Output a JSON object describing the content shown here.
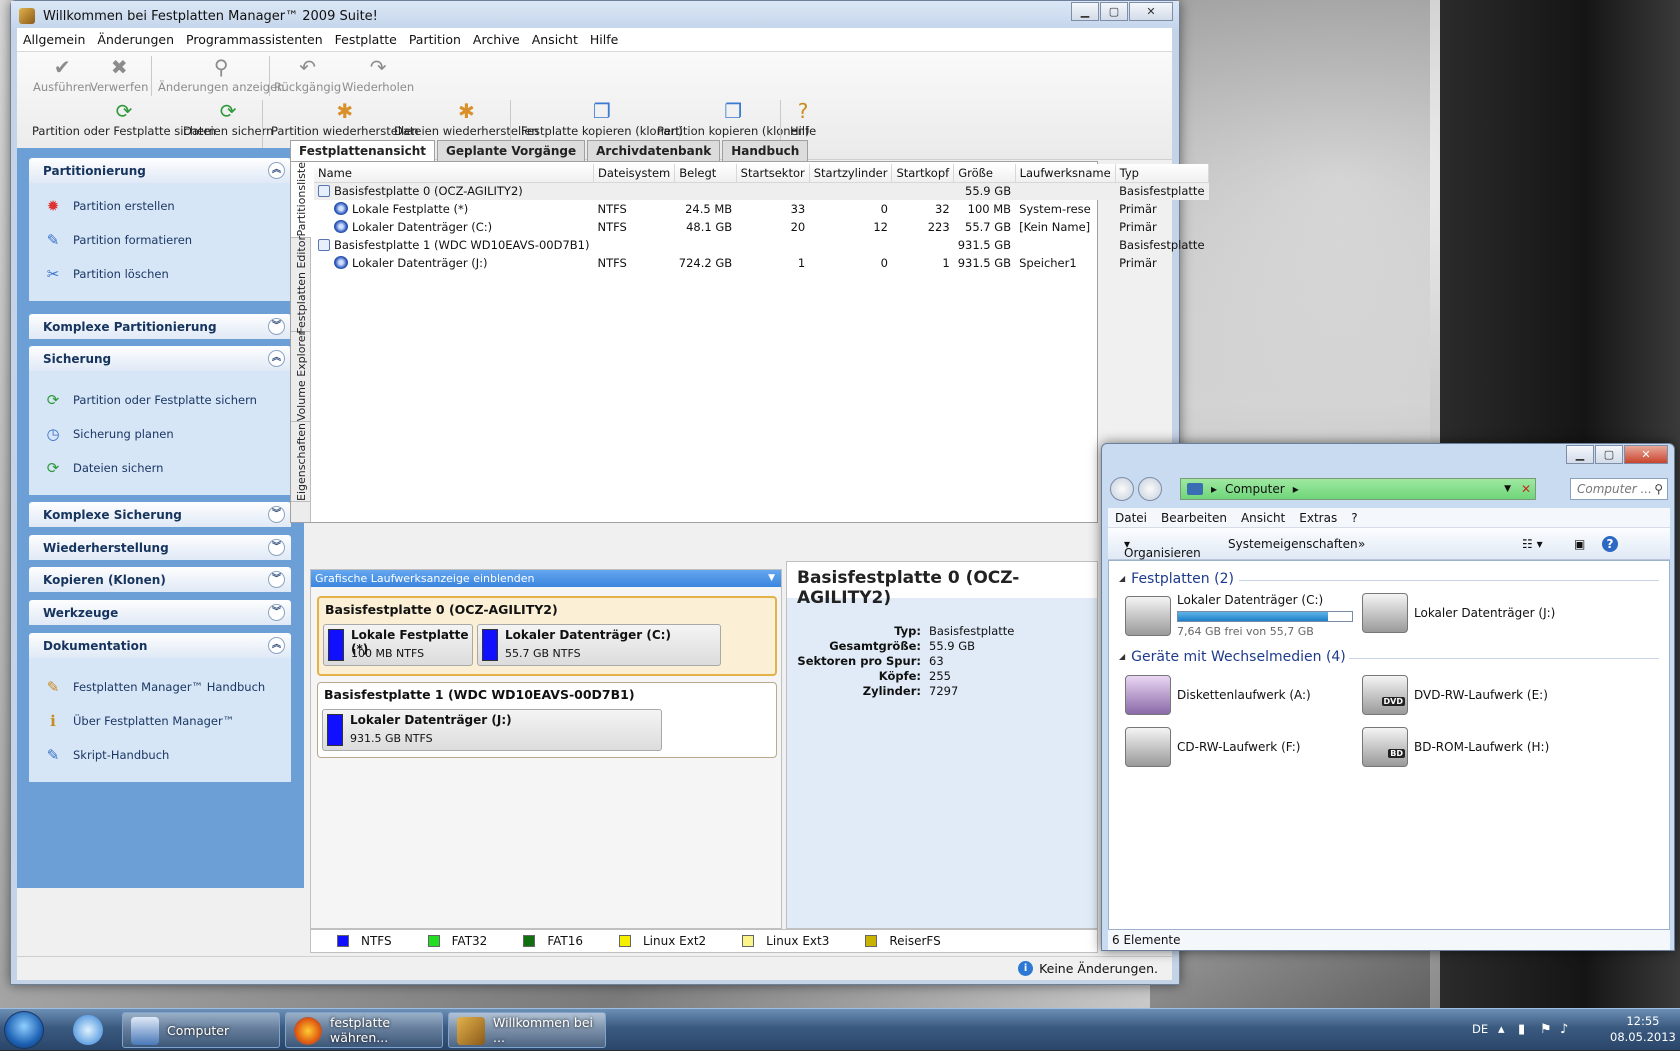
{
  "main_window": {
    "title": "Willkommen bei Festplatten Manager™ 2009 Suite!",
    "menu": [
      "Allgemein",
      "Änderungen",
      "Programmassistenten",
      "Festplatte",
      "Partition",
      "Archive",
      "Ansicht",
      "Hilfe"
    ],
    "toolbar_row1": [
      {
        "label": "Ausführen",
        "icon": "check-icon",
        "enabled": false
      },
      {
        "label": "Verwerfen",
        "icon": "x-icon",
        "enabled": false
      },
      {
        "label": "Änderungen anzeigen",
        "icon": "magnifier-icon",
        "enabled": false
      },
      {
        "label": "Rückgängig",
        "icon": "undo-icon",
        "enabled": false
      },
      {
        "label": "Wiederholen",
        "icon": "redo-icon",
        "enabled": false
      }
    ],
    "toolbar_row2": [
      {
        "label": "Partition oder Festplatte sichern",
        "icon": "backup-icon"
      },
      {
        "label": "Dateien sichern",
        "icon": "backup-files-icon"
      },
      {
        "label": "Partition wiederherstellen",
        "icon": "restore-icon"
      },
      {
        "label": "Dateien wiederherstellen",
        "icon": "restore-files-icon"
      },
      {
        "label": "Festplatte kopieren (klonen)",
        "icon": "clone-disk-icon"
      },
      {
        "label": "Partition kopieren (klonen)",
        "icon": "clone-partition-icon"
      },
      {
        "label": "Hilfe",
        "icon": "help-icon"
      }
    ],
    "sidebar": {
      "partitionierung": {
        "title": "Partitionierung",
        "items": [
          "Partition erstellen",
          "Partition formatieren",
          "Partition löschen"
        ]
      },
      "komplexe_partitionierung": {
        "title": "Komplexe Partitionierung"
      },
      "sicherung": {
        "title": "Sicherung",
        "items": [
          "Partition oder Festplatte sichern",
          "Sicherung planen",
          "Dateien sichern"
        ]
      },
      "komplexe_sicherung": {
        "title": "Komplexe Sicherung"
      },
      "wiederherstellung": {
        "title": "Wiederherstellung"
      },
      "kopieren": {
        "title": "Kopieren (Klonen)"
      },
      "werkzeuge": {
        "title": "Werkzeuge"
      },
      "dokumentation": {
        "title": "Dokumentation",
        "items": [
          "Festplatten Manager™ Handbuch",
          "Über Festplatten Manager™",
          "Skript-Handbuch"
        ]
      }
    },
    "tabs": [
      "Festplattenansicht",
      "Geplante Vorgänge",
      "Archivdatenbank",
      "Handbuch"
    ],
    "vertical_tabs": [
      "Partitionsliste",
      "Festplatten Editor",
      "Volume Explorer",
      "Eigenschaften"
    ],
    "table": {
      "headers": [
        "Name",
        "Dateisystem",
        "Belegt",
        "Startsektor",
        "Startzylinder",
        "Startkopf",
        "Größe",
        "Laufwerksname",
        "Typ"
      ],
      "rows": [
        [
          "Basisfestplatte 0 (OCZ-AGILITY2)",
          "",
          "",
          "",
          "",
          "",
          "55.9 GB",
          "",
          "Basisfestplatte"
        ],
        [
          "Lokale Festplatte (*)",
          "NTFS",
          "24.5 MB",
          "33",
          "0",
          "32",
          "100 MB",
          "System-rese",
          "Primär"
        ],
        [
          "Lokaler Datenträger (C:)",
          "NTFS",
          "48.1 GB",
          "20",
          "12",
          "223",
          "55.7 GB",
          "[Kein Name]",
          "Primär"
        ],
        [
          "Basisfestplatte 1 (WDC WD10EAVS-00D7B1)",
          "",
          "",
          "",
          "",
          "",
          "931.5 GB",
          "",
          "Basisfestplatte"
        ],
        [
          "Lokaler Datenträger (J:)",
          "NTFS",
          "724.2 GB",
          "1",
          "0",
          "1",
          "931.5 GB",
          "Speicher1",
          "Primär"
        ]
      ]
    },
    "graphic_bar": "Grafische Laufwerksanzeige einblenden",
    "disks": [
      {
        "title": "Basisfestplatte 0 (OCZ-AGILITY2)",
        "partitions": [
          {
            "name": "Lokale Festplatte (*)",
            "info": "100 MB NTFS"
          },
          {
            "name": "Lokaler Datenträger (C:)",
            "info": "55.7 GB NTFS"
          }
        ]
      },
      {
        "title": "Basisfestplatte 1 (WDC WD10EAVS-00D7B1)",
        "partitions": [
          {
            "name": "Lokaler Datenträger (J:)",
            "info": "931.5 GB NTFS"
          }
        ]
      }
    ],
    "detail": {
      "title": "Basisfestplatte 0 (OCZ-AGILITY2)",
      "rows": [
        {
          "k": "Typ:",
          "v": "Basisfestplatte"
        },
        {
          "k": "Gesamtgröße:",
          "v": "55.9 GB"
        },
        {
          "k": "Sektoren pro Spur:",
          "v": "63"
        },
        {
          "k": "Köpfe:",
          "v": "255"
        },
        {
          "k": "Zylinder:",
          "v": "7297"
        }
      ]
    },
    "legend": [
      {
        "label": "NTFS",
        "color": "#1010ff"
      },
      {
        "label": "FAT32",
        "color": "#22dd22"
      },
      {
        "label": "FAT16",
        "color": "#107010"
      },
      {
        "label": "Linux Ext2",
        "color": "#f4f000"
      },
      {
        "label": "Linux Ext3",
        "color": "#fbf48a"
      },
      {
        "label": "ReiserFS",
        "color": "#c8b400"
      }
    ],
    "status": "Keine Änderungen."
  },
  "explorer": {
    "address": "Computer",
    "search_placeholder": "Computer ...",
    "menu": [
      "Datei",
      "Bearbeiten",
      "Ansicht",
      "Extras",
      "?"
    ],
    "commands": {
      "organize": "Organisieren",
      "system": "Systemeigenschaften",
      "more": "»"
    },
    "group_disks": "Festplatten (2)",
    "group_removable": "Geräte mit Wechselmedien (4)",
    "drive_c": {
      "name": "Lokaler Datenträger (C:)",
      "free": "7,64 GB frei von 55,7 GB",
      "used_fraction": 0.863
    },
    "drive_j": {
      "name": "Lokaler Datenträger (J:)"
    },
    "removable": [
      {
        "name": "Diskettenlaufwerk (A:)",
        "badge": ""
      },
      {
        "name": "DVD-RW-Laufwerk (E:)",
        "badge": "DVD"
      },
      {
        "name": "CD-RW-Laufwerk (F:)",
        "badge": ""
      },
      {
        "name": "BD-ROM-Laufwerk (H:)",
        "badge": "BD"
      }
    ],
    "status": "6 Elemente"
  },
  "taskbar": {
    "items": [
      "Computer",
      "festplatte währen...",
      "Willkommen bei ..."
    ],
    "lang": "DE",
    "time": "12:55",
    "date": "08.05.2013"
  }
}
